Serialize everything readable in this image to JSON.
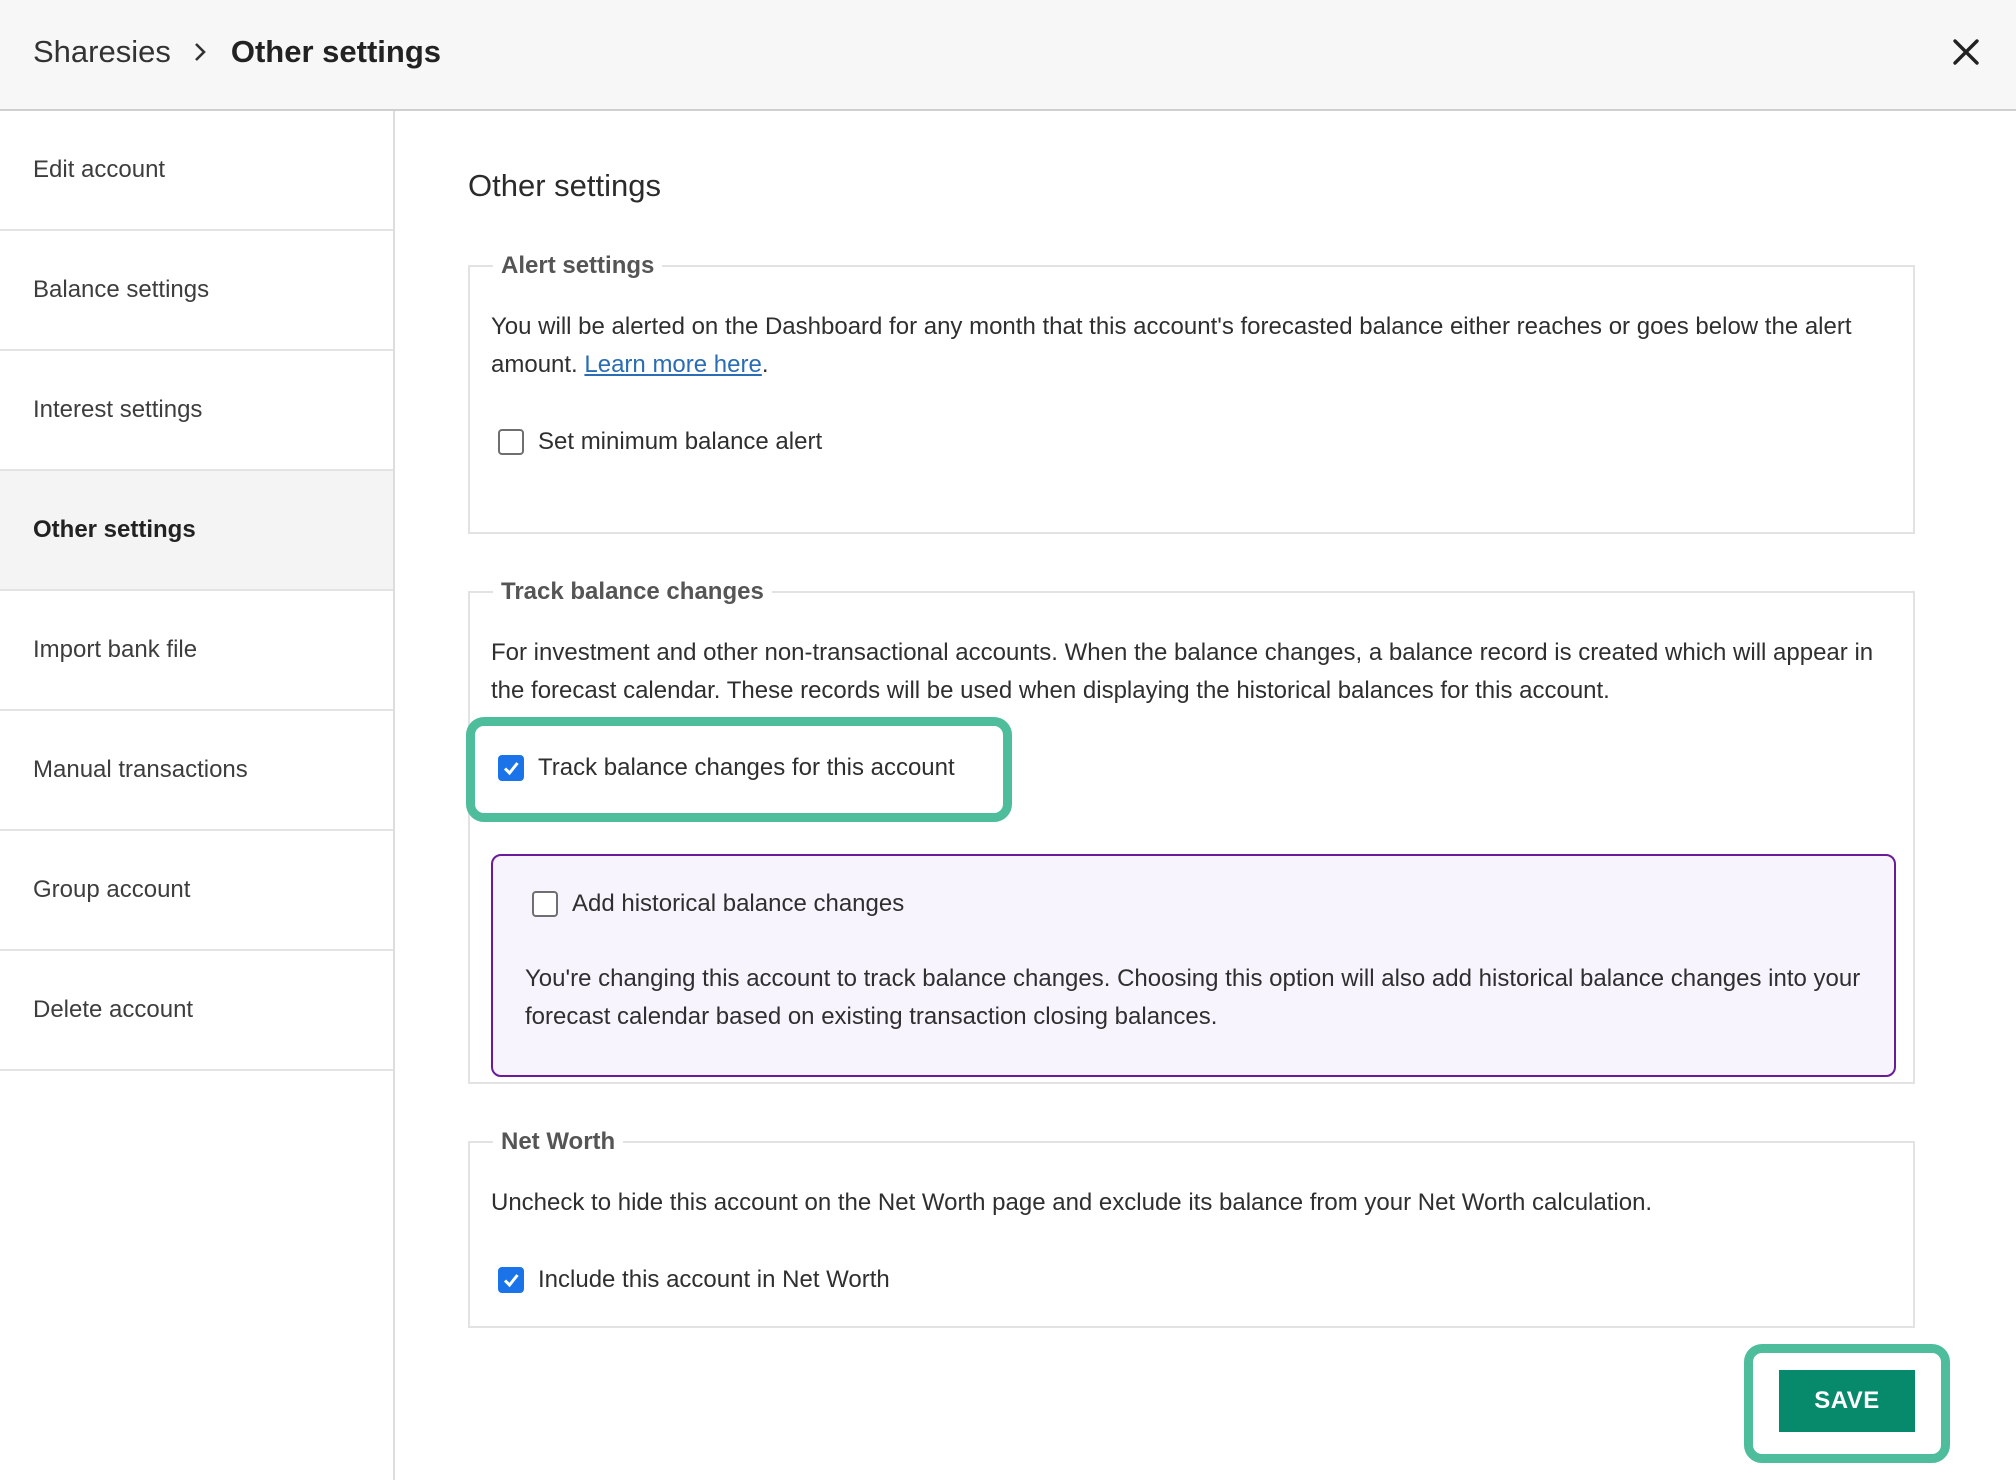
{
  "header": {
    "breadcrumb_root": "Sharesies",
    "breadcrumb_current": "Other settings"
  },
  "sidebar": {
    "items": [
      {
        "label": "Edit account"
      },
      {
        "label": "Balance settings"
      },
      {
        "label": "Interest settings"
      },
      {
        "label": "Other settings",
        "active": true
      },
      {
        "label": "Import bank file"
      },
      {
        "label": "Manual transactions"
      },
      {
        "label": "Group account"
      },
      {
        "label": "Delete account"
      }
    ]
  },
  "main": {
    "title": "Other settings",
    "alert": {
      "legend": "Alert settings",
      "description": "You will be alerted on the Dashboard for any month that this account's forecasted balance either reaches or goes below the alert amount. ",
      "link_text": "Learn more here",
      "after_link": ".",
      "checkbox_label": "Set minimum balance alert",
      "checked": false
    },
    "track": {
      "legend": "Track balance changes",
      "description": "For investment and other non-transactional accounts. When the balance changes, a balance record is created which will appear in the forecast calendar. These records will be used when displaying the historical balances for this account.",
      "checkbox_label": "Track balance changes for this account",
      "checked": true,
      "historical": {
        "checkbox_label": "Add historical balance changes",
        "checked": false,
        "description": "You're changing this account to track balance changes. Choosing this option will also add historical balance changes into your forecast calendar based on existing transaction closing balances."
      }
    },
    "networth": {
      "legend": "Net Worth",
      "description": "Uncheck to hide this account on the Net Worth page and exclude its balance from your Net Worth calculation.",
      "checkbox_label": "Include this account in Net Worth",
      "checked": true
    },
    "save_label": "SAVE"
  },
  "colors": {
    "highlight": "#4dbd9c",
    "save_button": "#078a6b",
    "checkbox_checked": "#1a73e8",
    "historical_border": "#6a1b9a",
    "historical_bg": "#f8f4fd"
  },
  "icons": {
    "breadcrumb_separator": "chevron-right-icon",
    "close": "close-icon",
    "checkmark": "checkmark-icon"
  }
}
